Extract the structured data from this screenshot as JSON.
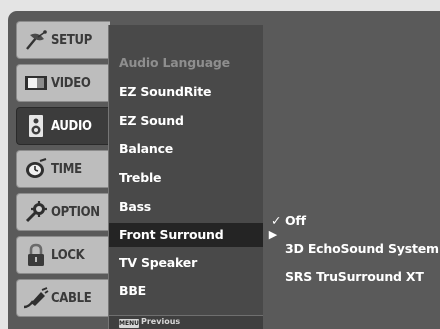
{
  "sidebar": {
    "items": [
      {
        "label": "SETUP",
        "icon": "satellite-dish-icon",
        "active": false
      },
      {
        "label": "VIDEO",
        "icon": "tv-screen-icon",
        "active": false
      },
      {
        "label": "AUDIO",
        "icon": "speaker-icon",
        "active": true
      },
      {
        "label": "TIME",
        "icon": "clock-icon",
        "active": false
      },
      {
        "label": "OPTION",
        "icon": "gear-wrench-icon",
        "active": false
      },
      {
        "label": "LOCK",
        "icon": "padlock-icon",
        "active": false
      },
      {
        "label": "CABLE",
        "icon": "cable-plug-icon",
        "active": false
      }
    ]
  },
  "submenu": {
    "items": [
      {
        "label": "Audio Language",
        "state": "disabled"
      },
      {
        "label": "EZ SoundRite",
        "state": "normal"
      },
      {
        "label": "EZ Sound",
        "state": "normal"
      },
      {
        "label": "Balance",
        "state": "normal"
      },
      {
        "label": "Treble",
        "state": "normal"
      },
      {
        "label": "Bass",
        "state": "normal"
      },
      {
        "label": "Front Surround",
        "state": "selected"
      },
      {
        "label": "TV Speaker",
        "state": "normal"
      },
      {
        "label": "BBE",
        "state": "normal"
      }
    ],
    "footer": {
      "button": "MENU",
      "label": "Previous"
    }
  },
  "options": {
    "items": [
      {
        "label": "Off",
        "checked": true
      },
      {
        "label": "3D EchoSound System",
        "checked": false
      },
      {
        "label": "SRS TruSurround XT",
        "checked": false
      }
    ],
    "check_glyph": "✓",
    "arrow_glyph": "▶"
  },
  "colors": {
    "background": "#5a5a5a",
    "panel": "#494949",
    "selected": "#242424",
    "tab_inactive": "#bdbdbd",
    "tab_active": "#3c3c3c"
  }
}
